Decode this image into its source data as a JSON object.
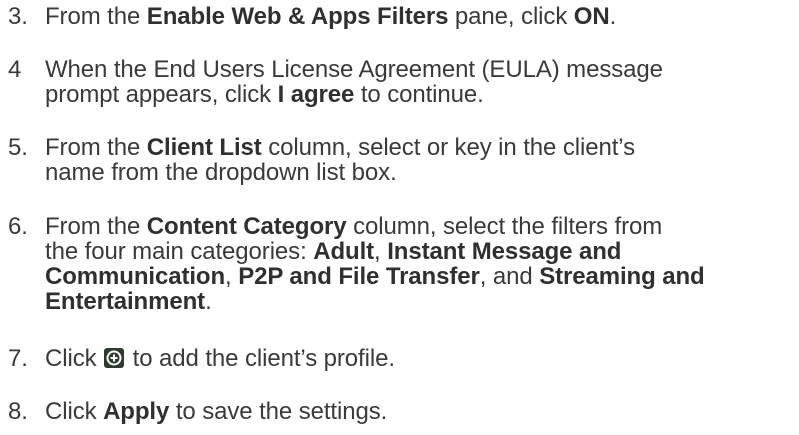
{
  "steps": [
    {
      "number": "3.",
      "parts": [
        {
          "t": "From the ",
          "b": false
        },
        {
          "t": "Enable Web & Apps Filters",
          "b": true
        },
        {
          "t": " pane, click ",
          "b": false
        },
        {
          "t": "ON",
          "b": true
        },
        {
          "t": ".",
          "b": false
        }
      ]
    },
    {
      "number": "4",
      "parts": [
        {
          "t": "When the End Users License Agreement (EULA) message",
          "b": false
        },
        {
          "br": true
        },
        {
          "t": "prompt appears, click ",
          "b": false
        },
        {
          "t": "I agree",
          "b": true
        },
        {
          "t": " to continue.",
          "b": false
        }
      ]
    },
    {
      "number": "5.",
      "parts": [
        {
          "t": "From the ",
          "b": false
        },
        {
          "t": "Client List",
          "b": true
        },
        {
          "t": " column, select or key in the client’s",
          "b": false
        },
        {
          "br": true
        },
        {
          "t": "name from the dropdown list box.",
          "b": false
        }
      ]
    },
    {
      "number": "6.",
      "parts": [
        {
          "t": "From the ",
          "b": false
        },
        {
          "t": "Content Category",
          "b": true
        },
        {
          "t": " column, select the filters from",
          "b": false
        },
        {
          "br": true
        },
        {
          "t": "the four main categories: ",
          "b": false
        },
        {
          "t": "Adult",
          "b": true
        },
        {
          "t": ", ",
          "b": false
        },
        {
          "t": "Instant Message and",
          "b": true
        },
        {
          "br": true
        },
        {
          "t": "Communication",
          "b": true
        },
        {
          "t": ", ",
          "b": false
        },
        {
          "t": "P2P and File Transfer",
          "b": true
        },
        {
          "t": ", and ",
          "b": false
        },
        {
          "t": "Streaming and",
          "b": true
        },
        {
          "br": true
        },
        {
          "t": "Entertainment",
          "b": true
        },
        {
          "t": ".",
          "b": false
        }
      ]
    },
    {
      "number": "7.",
      "parts": [
        {
          "t": "Click ",
          "b": false
        },
        {
          "icon": "add-circle-icon"
        },
        {
          "t": " to add the client’s profile.",
          "b": false
        }
      ]
    },
    {
      "number": "8.",
      "parts": [
        {
          "t": "Click ",
          "b": false
        },
        {
          "t": "Apply",
          "b": true
        },
        {
          "t": " to save the settings.",
          "b": false
        }
      ]
    }
  ],
  "colors": {
    "text": "#3a3a3a",
    "icon_background": "#2f3b2f",
    "icon_ring": "#ffffff"
  }
}
